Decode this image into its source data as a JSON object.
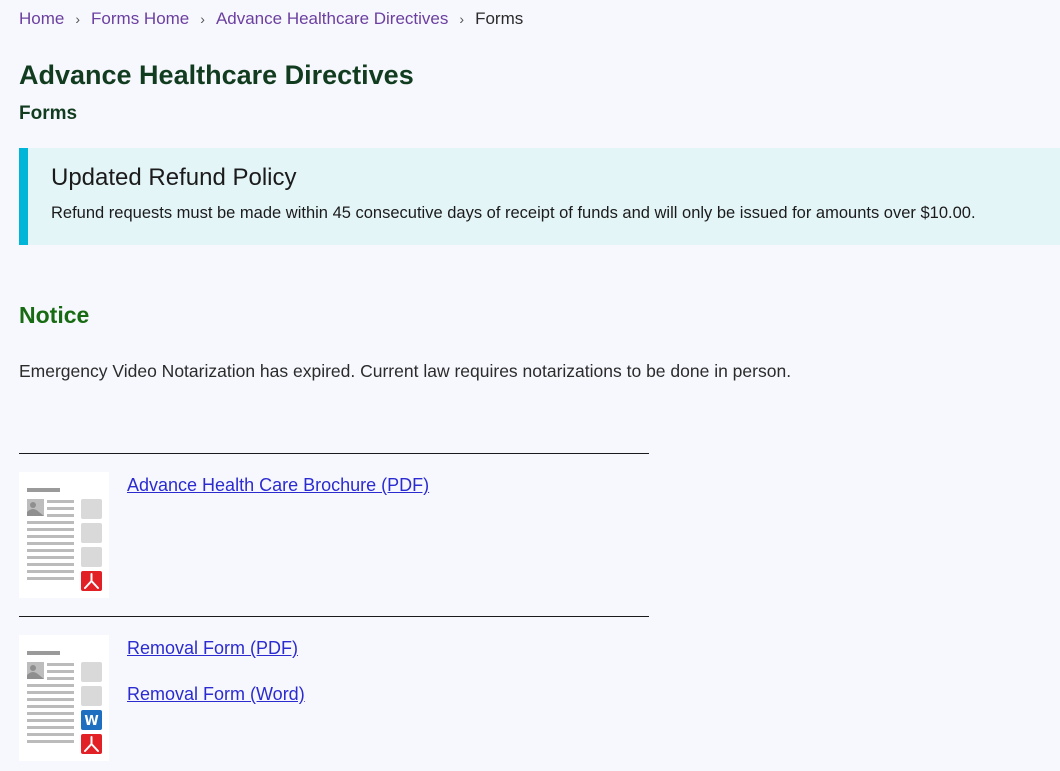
{
  "breadcrumb": {
    "items": [
      {
        "label": "Home"
      },
      {
        "label": "Forms Home"
      },
      {
        "label": "Advance Healthcare Directives"
      }
    ],
    "current": "Forms",
    "separator": "›"
  },
  "header": {
    "title": "Advance Healthcare Directives",
    "subtitle": "Forms"
  },
  "alert": {
    "title": "Updated Refund Policy",
    "body": "Refund requests must be made within 45 consecutive days of receipt of funds and will only be issued for amounts over $10.00.",
    "accent_color": "#00b6d8"
  },
  "notice": {
    "heading": "Notice",
    "text": "Emergency Video Notarization has expired. Current law requires notarizations to be done in person."
  },
  "documents": [
    {
      "thumbnail_icons": [
        "pdf-icon"
      ],
      "links": [
        {
          "label": "Advance Health Care Brochure (PDF)"
        }
      ]
    },
    {
      "thumbnail_icons": [
        "word-icon",
        "pdf-icon"
      ],
      "links": [
        {
          "label": "Removal Form (PDF)"
        },
        {
          "label": "Removal Form (Word)"
        }
      ]
    }
  ],
  "icons": {
    "word_letter": "W"
  },
  "colors": {
    "link": "#2b2bd0",
    "breadcrumb_link": "#6b3fa0",
    "heading": "#123c1f",
    "notice_heading": "#176b12",
    "pdf_red": "#e22127",
    "word_blue": "#1e6fbf"
  }
}
